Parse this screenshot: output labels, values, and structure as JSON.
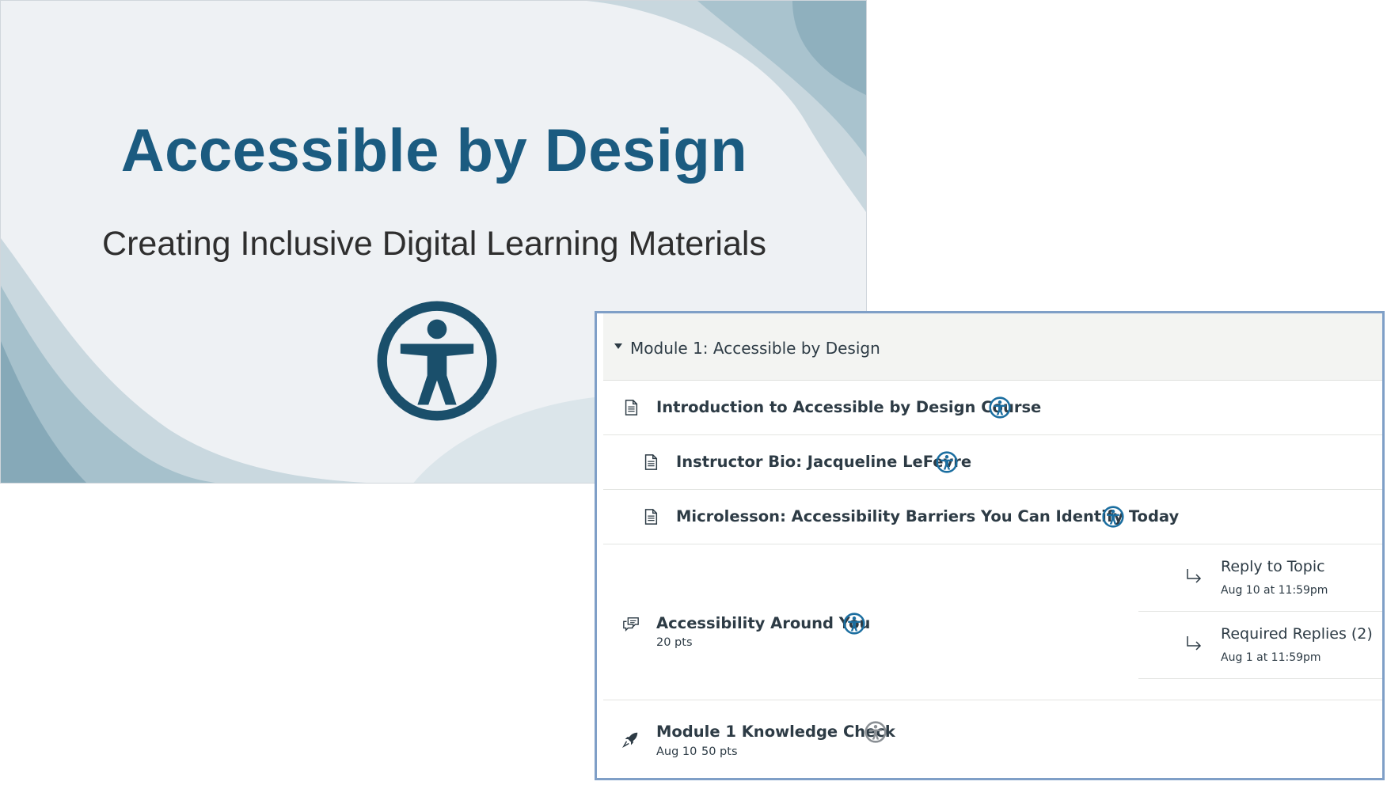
{
  "slide": {
    "title": "Accessible by Design",
    "subtitle": "Creating Inclusive Digital Learning Materials",
    "icon": "accessibility-icon",
    "colors": {
      "title": "#1b5b80",
      "wave": "#7fa3b3",
      "background": "#eef1f4"
    }
  },
  "module": {
    "title": "Module 1: Accessible by Design",
    "items": [
      {
        "type": "page",
        "title": "Introduction to Accessible by Design Course",
        "icon": "page-icon",
        "status_icon": "accessibility-icon"
      },
      {
        "type": "page",
        "title": "Instructor Bio: Jacqueline LeFevre",
        "icon": "page-icon",
        "status_icon": "accessibility-icon"
      },
      {
        "type": "page",
        "title": "Microlesson: Accessibility Barriers You Can Identify Today",
        "icon": "page-icon",
        "status_icon": "accessibility-icon"
      },
      {
        "type": "discussion",
        "title": "Accessibility Around You",
        "points": "20 pts",
        "icon": "discussion-icon",
        "status_icon": "accessibility-icon",
        "requirements": [
          {
            "title": "Reply to Topic",
            "due": "Aug 10 at 11:59pm"
          },
          {
            "title": "Required Replies (2)",
            "due": "Aug 1 at 11:59pm"
          }
        ]
      },
      {
        "type": "quiz",
        "title": "Module 1 Knowledge Check",
        "due": "Aug 10",
        "points": "50 pts",
        "icon": "quiz-rocket-icon",
        "status_icon": "accessibility-icon-gray"
      }
    ],
    "colors": {
      "accent": "#1b6ea0",
      "muted": "#8a8f94",
      "text": "#2d3b45",
      "border": "#7f9fc7"
    }
  }
}
